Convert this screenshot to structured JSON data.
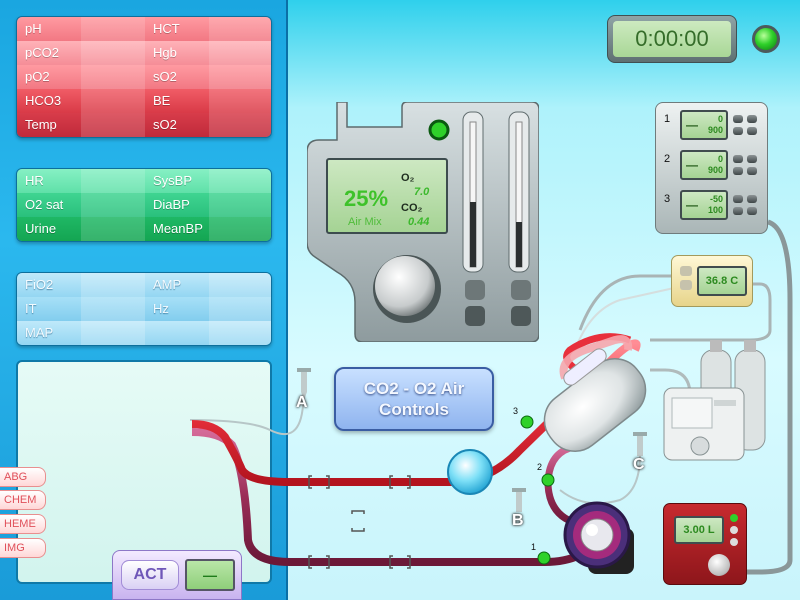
{
  "blood_gas_panel": {
    "rows": [
      {
        "left": "pH",
        "right": "HCT"
      },
      {
        "left": "pCO2",
        "right": "Hgb"
      },
      {
        "left": "pO2",
        "right": "sO2"
      },
      {
        "left": "HCO3",
        "right": "BE"
      },
      {
        "left": "Temp",
        "right": "sO2"
      }
    ]
  },
  "hemodynamics_panel": {
    "rows": [
      {
        "left": "HR",
        "right": "SysBP"
      },
      {
        "left": "O2 sat",
        "right": "DiaBP"
      },
      {
        "left": "Urine",
        "right": "MeanBP"
      }
    ]
  },
  "ventilator_panel": {
    "rows": [
      {
        "left": "FiO2",
        "right": "AMP"
      },
      {
        "left": "IT",
        "right": "Hz"
      },
      {
        "left": "MAP",
        "right": ""
      }
    ]
  },
  "side_tabs": [
    "ABG",
    "CHEM",
    "HEME",
    "IMG"
  ],
  "act": {
    "label": "ACT",
    "value": "—"
  },
  "timer": {
    "value": "0:00:00"
  },
  "gas_mixer": {
    "percent": "25%",
    "mode": "Air Mix",
    "o2_label": "O₂",
    "o2_value": "7.0",
    "co2_label": "CO₂",
    "co2_value": "0.44"
  },
  "controls_button": {
    "line1": "CO2 - O2 Air",
    "line2": "Controls"
  },
  "pumps": [
    {
      "num": "1",
      "dash": "—",
      "v1": "0",
      "v2": "900"
    },
    {
      "num": "2",
      "dash": "—",
      "v1": "0",
      "v2": "900"
    },
    {
      "num": "3",
      "dash": "—",
      "v1": "-50",
      "v2": "100"
    }
  ],
  "temperature": {
    "value": "36.8 C"
  },
  "flow": {
    "value": "3.00 L"
  },
  "circuit_labels": {
    "a": "A",
    "b": "B",
    "c": "C",
    "port1": "1",
    "port2": "2",
    "port3": "3"
  },
  "colors": {
    "arterial": "#e8303c",
    "venous": "#9a2d57",
    "led_green": "#2fd12a",
    "panel_blue": "#1aa6e0"
  }
}
